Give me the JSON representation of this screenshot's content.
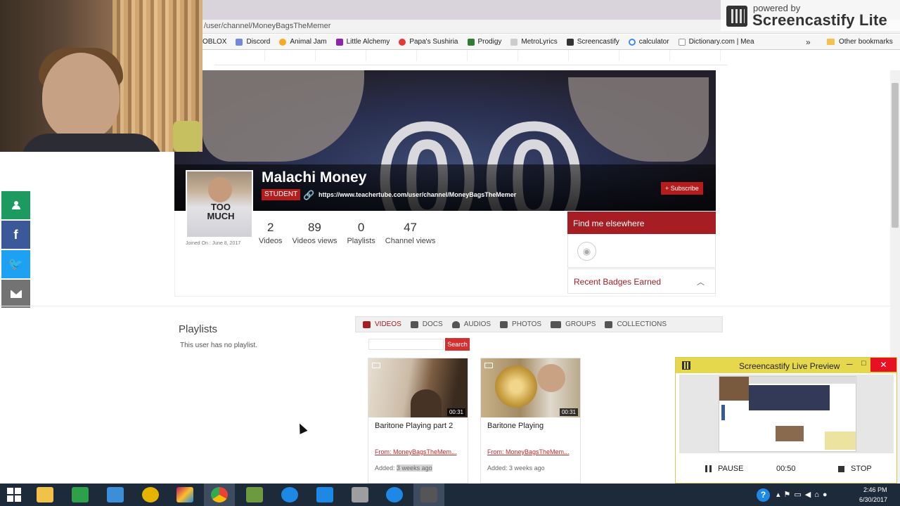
{
  "browser": {
    "address": "/user/channel/MoneyBagsTheMemer",
    "bookmarks": [
      {
        "label": "OBLOX",
        "color": "#c62828"
      },
      {
        "label": "Discord",
        "color": "#7289da"
      },
      {
        "label": "Animal Jam",
        "color": "#f9a825"
      },
      {
        "label": "Little Alchemy",
        "color": "#8e24aa"
      },
      {
        "label": "Papa's Sushiria",
        "color": "#e53935"
      },
      {
        "label": "Prodigy",
        "color": "#2e7d32"
      },
      {
        "label": "MetroLyrics",
        "color": "#555555"
      },
      {
        "label": "Screencastify",
        "color": "#333333"
      },
      {
        "label": "calculator",
        "color": "#4285f4"
      },
      {
        "label": "Dictionary.com | Mea",
        "color": "#e0e0e0"
      }
    ],
    "more": "»",
    "other_bookmarks": "Other bookmarks"
  },
  "watermark": {
    "line1": "powered by",
    "line2": "Screencastify Lite"
  },
  "profile": {
    "name": "Malachi Money",
    "role_badge": "STUDENT",
    "channel_url": "https://www.teachertube.com/user/channel/MoneyBagsTheMemer",
    "subscribe_label": "Subscribe",
    "joined": "Joined On : June 8, 2017",
    "avatar_text": "TOO MUCH",
    "banner_number": "00"
  },
  "stats": [
    {
      "value": "2",
      "label": "Videos"
    },
    {
      "value": "89",
      "label": "Videos views"
    },
    {
      "value": "0",
      "label": "Playlists"
    },
    {
      "value": "47",
      "label": "Channel views"
    }
  ],
  "find_me": {
    "title": "Find me elsewhere",
    "badges_title": "Recent Badges Earned"
  },
  "playlists": {
    "title": "Playlists",
    "empty_text": "This user has no playlist."
  },
  "media_tabs": [
    {
      "label": "VIDEOS",
      "active": true
    },
    {
      "label": "DOCS",
      "active": false
    },
    {
      "label": "AUDIOS",
      "active": false
    },
    {
      "label": "PHOTOS",
      "active": false
    },
    {
      "label": "GROUPS",
      "active": false
    },
    {
      "label": "COLLECTIONS",
      "active": false
    }
  ],
  "search": {
    "value": "",
    "button": "Search"
  },
  "videos": [
    {
      "title": "Baritone Playing part 2",
      "duration": "00:31",
      "from": "From: MoneyBagsTheMem...",
      "added_prefix": "Added:",
      "added_when": "3 weeks ago"
    },
    {
      "title": "Baritone Playing",
      "duration": "00:31",
      "from": "From: MoneyBagsTheMem...",
      "added_prefix": "Added:",
      "added_when": "3 weeks ago"
    }
  ],
  "live_preview": {
    "title": "Screencastify Live Preview",
    "pause_label": "PAUSE",
    "elapsed": "00:50",
    "stop_label": "STOP"
  },
  "taskbar": {
    "time": "2:46 PM",
    "date": "6/30/2017",
    "apps": [
      {
        "name": "file-explorer",
        "color": "#f0c24a"
      },
      {
        "name": "store",
        "color": "#2ea04a"
      },
      {
        "name": "app-blue",
        "color": "#3b8fd9"
      },
      {
        "name": "app-yellow",
        "color": "#e5b400"
      },
      {
        "name": "app-multicolor",
        "color": "#c2185b"
      },
      {
        "name": "chrome",
        "color": "#4285f4"
      },
      {
        "name": "minecraft",
        "color": "#6d9a3e"
      },
      {
        "name": "internet-explorer",
        "color": "#1e88e5"
      },
      {
        "name": "app-azure",
        "color": "#1e88e5"
      },
      {
        "name": "camera",
        "color": "#9e9e9e"
      },
      {
        "name": "help",
        "color": "#1e88e5"
      },
      {
        "name": "screencastify",
        "color": "#555555"
      }
    ]
  }
}
